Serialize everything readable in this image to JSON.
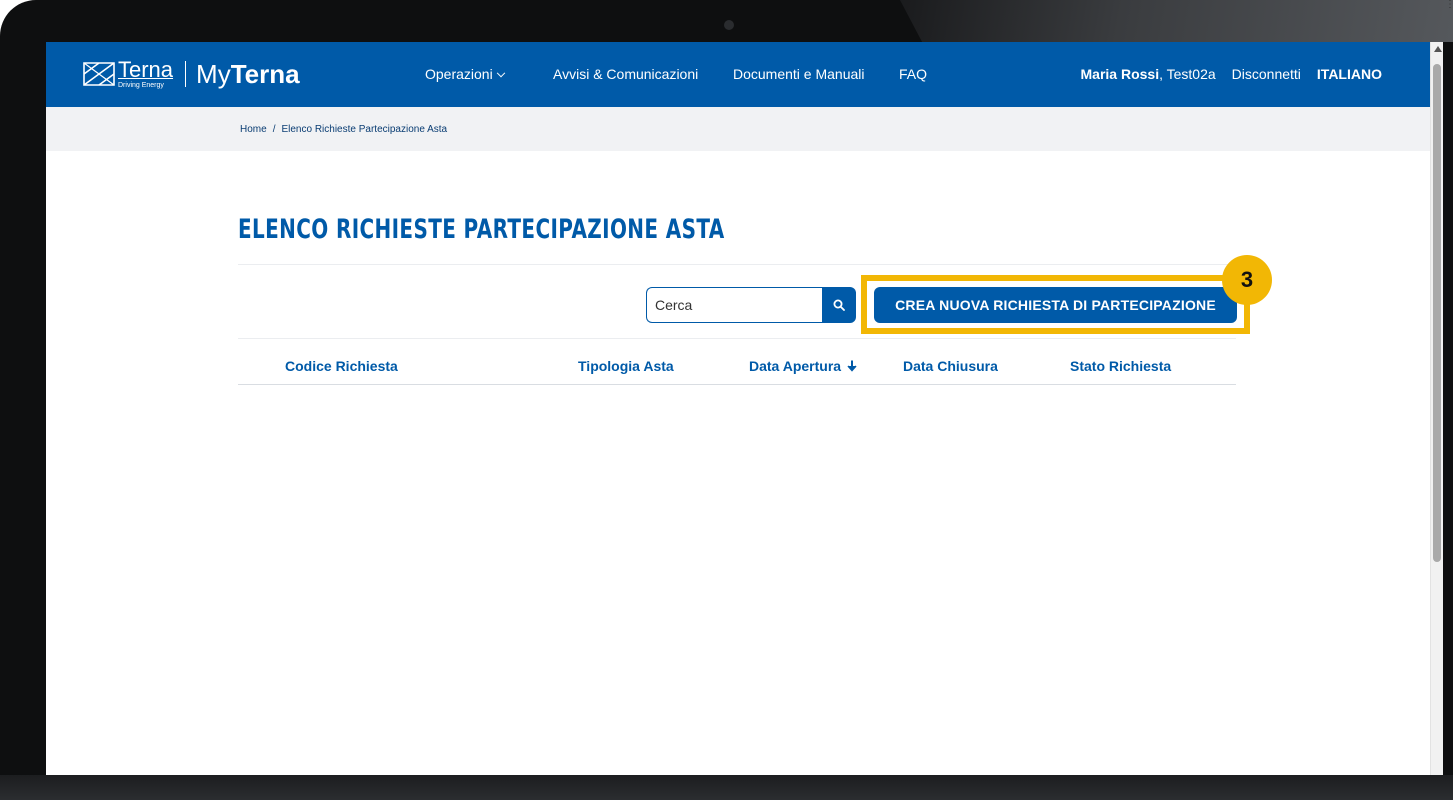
{
  "header": {
    "logo_brand": "Terna",
    "logo_tagline": "Driving Energy",
    "logo_my": "My",
    "logo_terna": "Terna",
    "nav": [
      {
        "label": "Operazioni"
      },
      {
        "label": "Avvisi & Comunicazioni"
      },
      {
        "label": "Documenti e Manuali"
      },
      {
        "label": "FAQ"
      }
    ],
    "user_name": "Maria Rossi",
    "user_suffix": ", Test02a",
    "logout": "Disconnetti",
    "language": "ITALIANO"
  },
  "breadcrumb": {
    "home": "Home",
    "separator": "/",
    "current": "Elenco Richieste Partecipazione Asta"
  },
  "main": {
    "title": "ELENCO RICHIESTE PARTECIPAZIONE ASTA",
    "search_placeholder": "Cerca",
    "create_button": "CREA NUOVA RICHIESTA DI PARTECIPAZIONE",
    "step_badge": "3",
    "columns": [
      {
        "label": "Codice Richiesta"
      },
      {
        "label": "Tipologia Asta"
      },
      {
        "label": "Data Apertura"
      },
      {
        "label": "Data Chiusura"
      },
      {
        "label": "Stato Richiesta"
      }
    ],
    "sort_column": "Data Apertura",
    "sort_direction": "descending"
  },
  "colors": {
    "primary_blue": "#005aa8",
    "highlight_yellow": "#f2b705",
    "breadcrumb_bg": "#f1f2f4"
  }
}
